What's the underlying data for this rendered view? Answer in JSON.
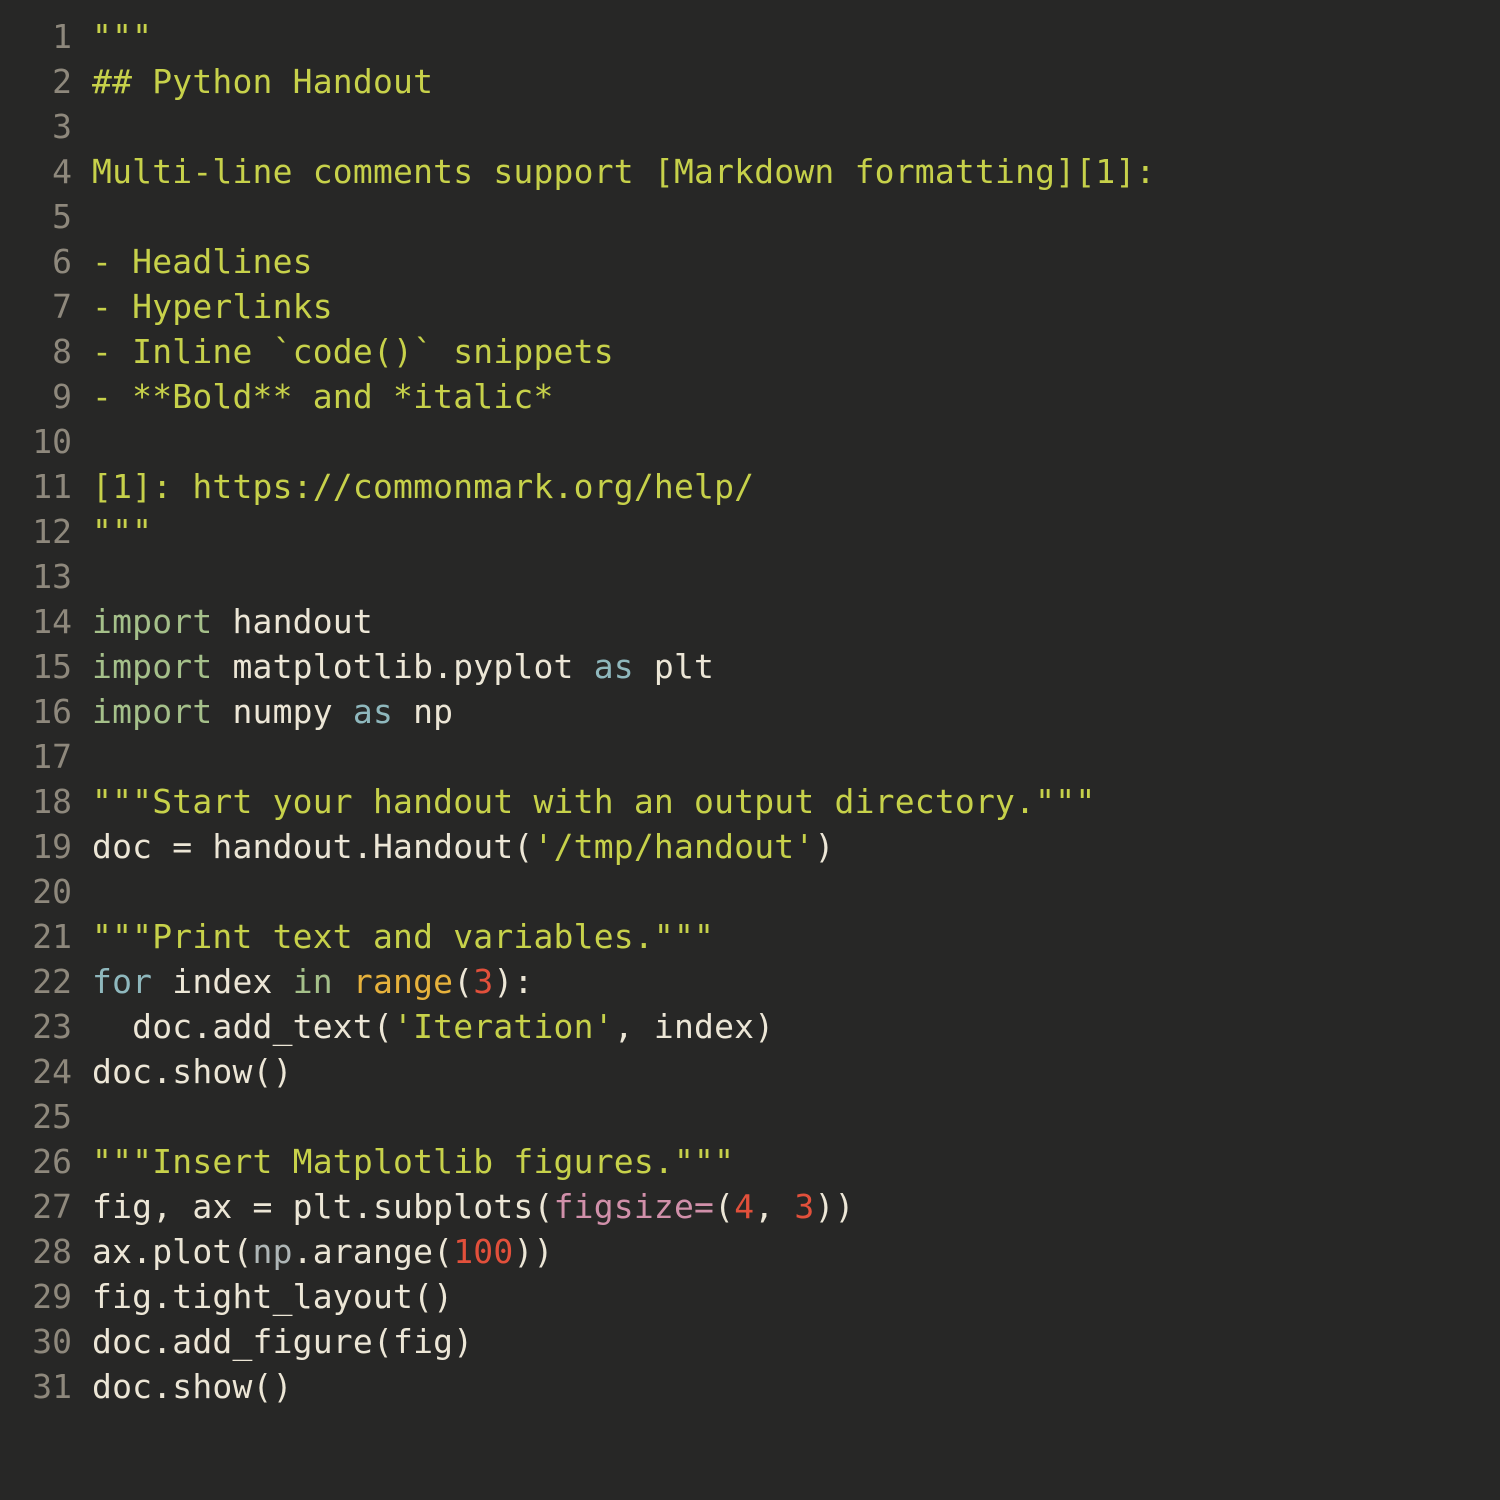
{
  "editor": {
    "language": "python",
    "theme": "dark-charcoal",
    "background_color": "#272726",
    "gutter_color": "#8e887c",
    "default_text_color": "#ece6d6",
    "total_lines": 31,
    "colors": {
      "comment": "#c7d14a",
      "string": "#c7d14a",
      "keyword": "#8fb8bd",
      "keyword_green": "#a5c08a",
      "builtin": "#e7b23c",
      "number": "#e2503b",
      "keyword_argument": "#d190aa",
      "module": "#aeb6b6",
      "plain": "#ece6d6"
    },
    "line_numbers": [
      "1",
      "2",
      "3",
      "4",
      "5",
      "6",
      "7",
      "8",
      "9",
      "10",
      "11",
      "12",
      "13",
      "14",
      "15",
      "16",
      "17",
      "18",
      "19",
      "20",
      "21",
      "22",
      "23",
      "24",
      "25",
      "26",
      "27",
      "28",
      "29",
      "30",
      "31"
    ],
    "lines": [
      {
        "n": "1",
        "tokens": [
          {
            "t": "\"\"\"",
            "c": "comment"
          }
        ]
      },
      {
        "n": "2",
        "tokens": [
          {
            "t": "## Python Handout",
            "c": "comment"
          }
        ]
      },
      {
        "n": "3",
        "tokens": []
      },
      {
        "n": "4",
        "tokens": [
          {
            "t": "Multi-line comments support [Markdown formatting][1]:",
            "c": "comment"
          }
        ]
      },
      {
        "n": "5",
        "tokens": []
      },
      {
        "n": "6",
        "tokens": [
          {
            "t": "- Headlines",
            "c": "comment"
          }
        ]
      },
      {
        "n": "7",
        "tokens": [
          {
            "t": "- Hyperlinks",
            "c": "comment"
          }
        ]
      },
      {
        "n": "8",
        "tokens": [
          {
            "t": "- Inline `code()` snippets",
            "c": "comment"
          }
        ]
      },
      {
        "n": "9",
        "tokens": [
          {
            "t": "- **Bold** and *italic*",
            "c": "comment"
          }
        ]
      },
      {
        "n": "10",
        "tokens": []
      },
      {
        "n": "11",
        "tokens": [
          {
            "t": "[1]: https://commonmark.org/help/",
            "c": "comment"
          }
        ]
      },
      {
        "n": "12",
        "tokens": [
          {
            "t": "\"\"\"",
            "c": "comment"
          }
        ]
      },
      {
        "n": "13",
        "tokens": []
      },
      {
        "n": "14",
        "tokens": [
          {
            "t": "import",
            "c": "keyword_green"
          },
          {
            "t": " handout",
            "c": "plain"
          }
        ]
      },
      {
        "n": "15",
        "tokens": [
          {
            "t": "import",
            "c": "keyword_green"
          },
          {
            "t": " matplotlib.pyplot ",
            "c": "plain"
          },
          {
            "t": "as",
            "c": "keyword"
          },
          {
            "t": " plt",
            "c": "plain"
          }
        ]
      },
      {
        "n": "16",
        "tokens": [
          {
            "t": "import",
            "c": "keyword_green"
          },
          {
            "t": " numpy ",
            "c": "plain"
          },
          {
            "t": "as",
            "c": "keyword"
          },
          {
            "t": " np",
            "c": "plain"
          }
        ]
      },
      {
        "n": "17",
        "tokens": []
      },
      {
        "n": "18",
        "tokens": [
          {
            "t": "\"\"\"Start your handout with an output directory.\"\"\"",
            "c": "comment"
          }
        ]
      },
      {
        "n": "19",
        "tokens": [
          {
            "t": "doc = handout.Handout(",
            "c": "plain"
          },
          {
            "t": "'/tmp/handout'",
            "c": "string"
          },
          {
            "t": ")",
            "c": "plain"
          }
        ]
      },
      {
        "n": "20",
        "tokens": []
      },
      {
        "n": "21",
        "tokens": [
          {
            "t": "\"\"\"Print text and variables.\"\"\"",
            "c": "comment"
          }
        ]
      },
      {
        "n": "22",
        "tokens": [
          {
            "t": "for",
            "c": "keyword"
          },
          {
            "t": " index ",
            "c": "plain"
          },
          {
            "t": "in",
            "c": "keyword_green"
          },
          {
            "t": " ",
            "c": "plain"
          },
          {
            "t": "range",
            "c": "builtin"
          },
          {
            "t": "(",
            "c": "plain"
          },
          {
            "t": "3",
            "c": "number"
          },
          {
            "t": "):",
            "c": "plain"
          }
        ]
      },
      {
        "n": "23",
        "tokens": [
          {
            "t": "  doc.add_text(",
            "c": "plain"
          },
          {
            "t": "'Iteration'",
            "c": "string"
          },
          {
            "t": ", index)",
            "c": "plain"
          }
        ]
      },
      {
        "n": "24",
        "tokens": [
          {
            "t": "doc.show()",
            "c": "plain"
          }
        ]
      },
      {
        "n": "25",
        "tokens": []
      },
      {
        "n": "26",
        "tokens": [
          {
            "t": "\"\"\"Insert Matplotlib figures.\"\"\"",
            "c": "comment"
          }
        ]
      },
      {
        "n": "27",
        "tokens": [
          {
            "t": "fig, ax = plt.subplots(",
            "c": "plain"
          },
          {
            "t": "figsize=",
            "c": "keyword_argument"
          },
          {
            "t": "(",
            "c": "plain"
          },
          {
            "t": "4",
            "c": "number"
          },
          {
            "t": ", ",
            "c": "plain"
          },
          {
            "t": "3",
            "c": "number"
          },
          {
            "t": "))",
            "c": "plain"
          }
        ]
      },
      {
        "n": "28",
        "tokens": [
          {
            "t": "ax.plot(",
            "c": "plain"
          },
          {
            "t": "np",
            "c": "module"
          },
          {
            "t": ".arange(",
            "c": "plain"
          },
          {
            "t": "100",
            "c": "number"
          },
          {
            "t": "))",
            "c": "plain"
          }
        ]
      },
      {
        "n": "29",
        "tokens": [
          {
            "t": "fig.tight_layout()",
            "c": "plain"
          }
        ]
      },
      {
        "n": "30",
        "tokens": [
          {
            "t": "doc.add_figure(fig)",
            "c": "plain"
          }
        ]
      },
      {
        "n": "31",
        "tokens": [
          {
            "t": "doc.show()",
            "c": "plain"
          }
        ]
      }
    ]
  }
}
